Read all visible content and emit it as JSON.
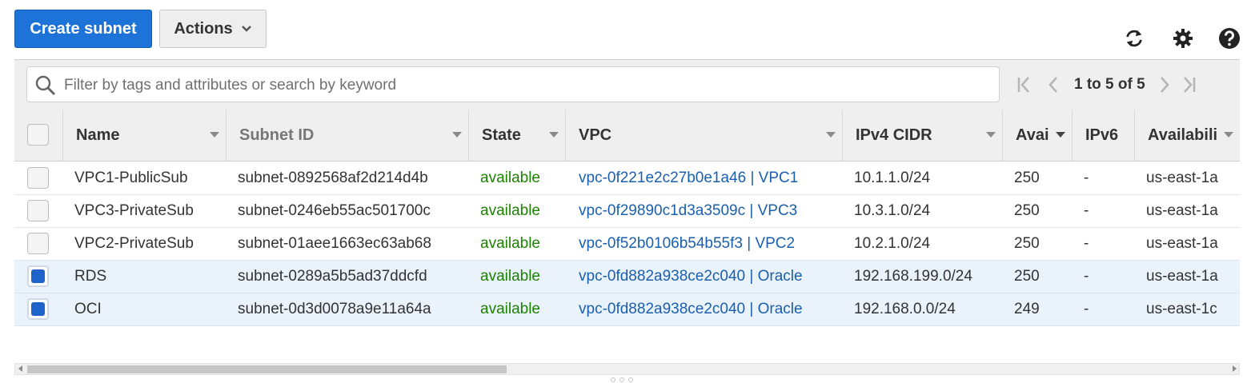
{
  "toolbar": {
    "create_label": "Create subnet",
    "actions_label": "Actions",
    "icons": [
      "refresh-icon",
      "gear-icon",
      "help-icon"
    ]
  },
  "filter": {
    "placeholder": "Filter by tags and attributes or search by keyword",
    "value": ""
  },
  "pagination": {
    "text": "1 to 5 of 5"
  },
  "columns": [
    "Name",
    "Subnet ID",
    "State",
    "VPC",
    "IPv4 CIDR",
    "Avai",
    "IPv6",
    "Availabili"
  ],
  "rows": [
    {
      "selected": false,
      "name": "VPC1-PublicSub",
      "subnet_id": "subnet-0892568af2d214d4b",
      "state": "available",
      "vpc": "vpc-0f221e2c27b0e1a46 | VPC1",
      "cidr": "10.1.1.0/24",
      "available_ips": "250",
      "ipv6": "-",
      "az": "us-east-1a"
    },
    {
      "selected": false,
      "name": "VPC3-PrivateSub",
      "subnet_id": "subnet-0246eb55ac501700c",
      "state": "available",
      "vpc": "vpc-0f29890c1d3a3509c | VPC3",
      "cidr": "10.3.1.0/24",
      "available_ips": "250",
      "ipv6": "-",
      "az": "us-east-1a"
    },
    {
      "selected": false,
      "name": "VPC2-PrivateSub",
      "subnet_id": "subnet-01aee1663ec63ab68",
      "state": "available",
      "vpc": "vpc-0f52b0106b54b55f3 | VPC2",
      "cidr": "10.2.1.0/24",
      "available_ips": "250",
      "ipv6": "-",
      "az": "us-east-1a"
    },
    {
      "selected": true,
      "name": "RDS",
      "subnet_id": "subnet-0289a5b5ad37ddcfd",
      "state": "available",
      "vpc": "vpc-0fd882a938ce2c040 | Oracle",
      "cidr": "192.168.199.0/24",
      "available_ips": "250",
      "ipv6": "-",
      "az": "us-east-1a"
    },
    {
      "selected": true,
      "name": "OCI",
      "subnet_id": "subnet-0d3d0078a9e11a64a",
      "state": "available",
      "vpc": "vpc-0fd882a938ce2c040 | Oracle",
      "cidr": "192.168.0.0/24",
      "available_ips": "249",
      "ipv6": "-",
      "az": "us-east-1c"
    }
  ],
  "colors": {
    "primary": "#1e73d8",
    "state_available": "#1d8102",
    "link": "#1a5fae",
    "selected_row": "#eaf2fc"
  }
}
